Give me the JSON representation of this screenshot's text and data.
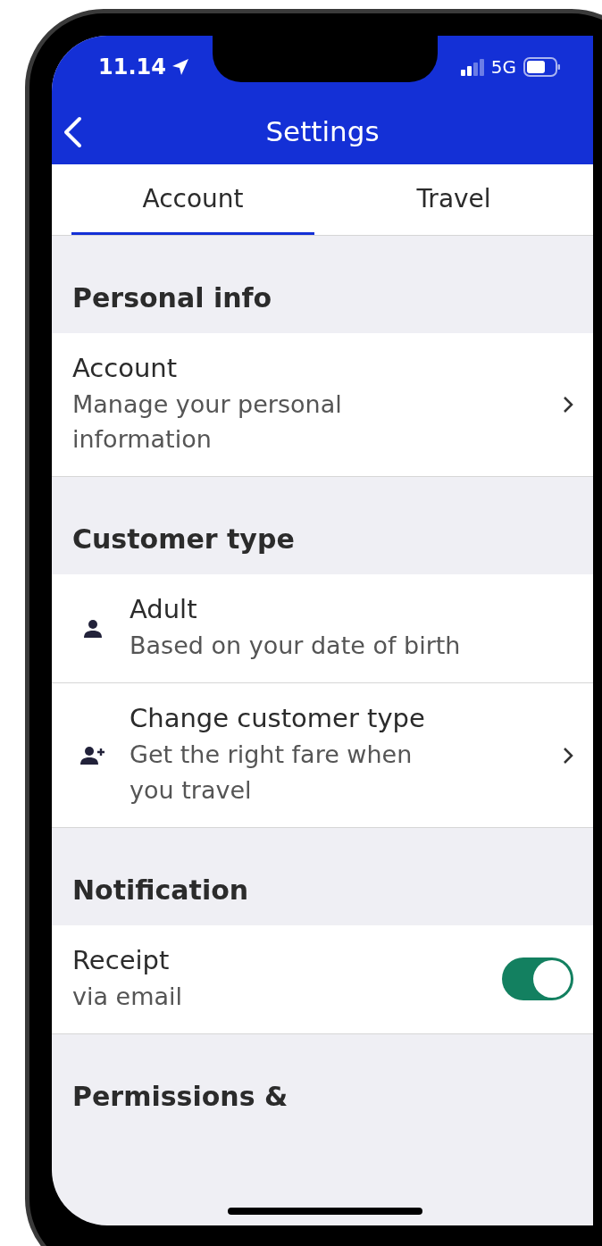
{
  "status_bar": {
    "time": "11.14",
    "network": "5G"
  },
  "header": {
    "title": "Settings"
  },
  "tabs": [
    {
      "label": "Account",
      "selected": true
    },
    {
      "label": "Travel",
      "selected": false
    }
  ],
  "sections": [
    {
      "title": "Personal info",
      "rows": [
        {
          "kind": "link",
          "title": "Account",
          "subtitle": "Manage your personal information"
        }
      ]
    },
    {
      "title": "Customer type",
      "rows": [
        {
          "kind": "info",
          "title": "Adult",
          "subtitle": "Based on your date of birth"
        },
        {
          "kind": "icon-link",
          "title": "Change customer type",
          "subtitle": "Get the right fare when you travel"
        }
      ]
    },
    {
      "title": "Notification",
      "rows": [
        {
          "kind": "toggle",
          "title": "Receipt",
          "subtitle": "via email",
          "on": true
        }
      ]
    },
    {
      "title": "Permissions &"
    }
  ]
}
